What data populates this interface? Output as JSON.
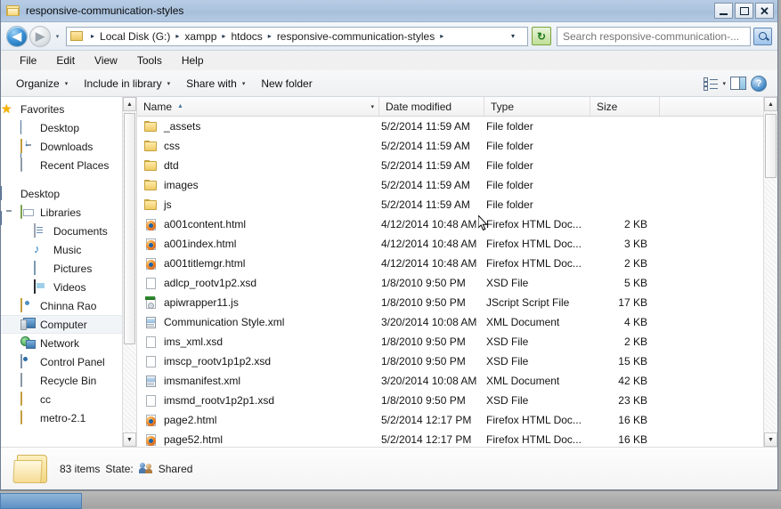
{
  "window": {
    "title": "responsive-communication-styles",
    "buttons": {
      "minimize": "–",
      "maximize": "□",
      "close": "✕"
    }
  },
  "address": {
    "back_glyph": "◀",
    "forward_glyph": "▶",
    "history_glyph": "▾",
    "crumbs": [
      "Local Disk (G:)",
      "xampp",
      "htdocs",
      "responsive-communication-styles"
    ],
    "separator": "▸",
    "end_dropdown": "▾",
    "refresh_glyph": "↻"
  },
  "search": {
    "placeholder": "Search responsive-communication-...",
    "value": ""
  },
  "menu": {
    "items": [
      "File",
      "Edit",
      "View",
      "Tools",
      "Help"
    ]
  },
  "toolbar": {
    "items": [
      {
        "label": "Organize",
        "caret": "▾"
      },
      {
        "label": "Include in library",
        "caret": "▾"
      },
      {
        "label": "Share with",
        "caret": "▾"
      },
      {
        "label": "New folder",
        "caret": ""
      }
    ],
    "view_caret": "▾",
    "help_glyph": "?"
  },
  "sidebar": {
    "items": [
      {
        "label": "Favorites",
        "icon": "star-icon",
        "level": 0,
        "selected": false
      },
      {
        "label": "Desktop",
        "icon": "monitor-icon",
        "level": 1,
        "selected": false
      },
      {
        "label": "Downloads",
        "icon": "downloads-folder-icon",
        "level": 1,
        "selected": false
      },
      {
        "label": "Recent Places",
        "icon": "recent-places-icon",
        "level": 1,
        "selected": false
      },
      {
        "label": "Desktop",
        "icon": "monitor-icon",
        "level": 0,
        "selected": false
      },
      {
        "label": "Libraries",
        "icon": "libraries-icon",
        "level": 1,
        "selected": false
      },
      {
        "label": "Documents",
        "icon": "documents-icon",
        "level": 2,
        "selected": false
      },
      {
        "label": "Music",
        "icon": "music-icon",
        "level": 2,
        "selected": false
      },
      {
        "label": "Pictures",
        "icon": "pictures-icon",
        "level": 2,
        "selected": false
      },
      {
        "label": "Videos",
        "icon": "videos-icon",
        "level": 2,
        "selected": false
      },
      {
        "label": "Chinna Rao",
        "icon": "user-folder-icon",
        "level": 1,
        "selected": false
      },
      {
        "label": "Computer",
        "icon": "computer-icon",
        "level": 1,
        "selected": true
      },
      {
        "label": "Network",
        "icon": "network-icon",
        "level": 1,
        "selected": false
      },
      {
        "label": "Control Panel",
        "icon": "control-panel-icon",
        "level": 1,
        "selected": false
      },
      {
        "label": "Recycle Bin",
        "icon": "recycle-bin-icon",
        "level": 1,
        "selected": false
      },
      {
        "label": "cc",
        "icon": "folder-icon",
        "level": 1,
        "selected": false
      },
      {
        "label": "metro-2.1",
        "icon": "folder-icon",
        "level": 1,
        "selected": false
      }
    ]
  },
  "columns": {
    "name": "Name",
    "date": "Date modified",
    "type": "Type",
    "size": "Size",
    "sort_arrow": "▲",
    "name_dropdown": "▾"
  },
  "files": [
    {
      "name": "_assets",
      "date": "5/2/2014 11:59 AM",
      "type": "File folder",
      "size": "",
      "icon": "folder-icon"
    },
    {
      "name": "css",
      "date": "5/2/2014 11:59 AM",
      "type": "File folder",
      "size": "",
      "icon": "folder-icon"
    },
    {
      "name": "dtd",
      "date": "5/2/2014 11:59 AM",
      "type": "File folder",
      "size": "",
      "icon": "folder-icon"
    },
    {
      "name": "images",
      "date": "5/2/2014 11:59 AM",
      "type": "File folder",
      "size": "",
      "icon": "folder-icon"
    },
    {
      "name": "js",
      "date": "5/2/2014 11:59 AM",
      "type": "File folder",
      "size": "",
      "icon": "folder-icon"
    },
    {
      "name": "a001content.html",
      "date": "4/12/2014 10:48 AM",
      "type": "Firefox HTML Doc...",
      "size": "2 KB",
      "icon": "firefox-html-icon"
    },
    {
      "name": "a001index.html",
      "date": "4/12/2014 10:48 AM",
      "type": "Firefox HTML Doc...",
      "size": "3 KB",
      "icon": "firefox-html-icon"
    },
    {
      "name": "a001titlemgr.html",
      "date": "4/12/2014 10:48 AM",
      "type": "Firefox HTML Doc...",
      "size": "2 KB",
      "icon": "firefox-html-icon"
    },
    {
      "name": "adlcp_rootv1p2.xsd",
      "date": "1/8/2010 9:50 PM",
      "type": "XSD File",
      "size": "5 KB",
      "icon": "generic-file-icon"
    },
    {
      "name": "apiwrapper11.js",
      "date": "1/8/2010 9:50 PM",
      "type": "JScript Script File",
      "size": "17 KB",
      "icon": "jscript-icon"
    },
    {
      "name": "Communication Style.xml",
      "date": "3/20/2014 10:08 AM",
      "type": "XML Document",
      "size": "4 KB",
      "icon": "xml-icon"
    },
    {
      "name": "ims_xml.xsd",
      "date": "1/8/2010 9:50 PM",
      "type": "XSD File",
      "size": "2 KB",
      "icon": "generic-file-icon"
    },
    {
      "name": "imscp_rootv1p1p2.xsd",
      "date": "1/8/2010 9:50 PM",
      "type": "XSD File",
      "size": "15 KB",
      "icon": "generic-file-icon"
    },
    {
      "name": "imsmanifest.xml",
      "date": "3/20/2014 10:08 AM",
      "type": "XML Document",
      "size": "42 KB",
      "icon": "xml-icon"
    },
    {
      "name": "imsmd_rootv1p2p1.xsd",
      "date": "1/8/2010 9:50 PM",
      "type": "XSD File",
      "size": "23 KB",
      "icon": "generic-file-icon"
    },
    {
      "name": "page2.html",
      "date": "5/2/2014 12:17 PM",
      "type": "Firefox HTML Doc...",
      "size": "16 KB",
      "icon": "firefox-html-icon"
    },
    {
      "name": "page52.html",
      "date": "5/2/2014 12:17 PM",
      "type": "Firefox HTML Doc...",
      "size": "16 KB",
      "icon": "firefox-html-icon"
    }
  ],
  "status": {
    "item_count": "83 items",
    "state_label": "State:",
    "state_value": "Shared"
  },
  "scroll": {
    "up_glyph": "▲",
    "down_glyph": "▼"
  }
}
